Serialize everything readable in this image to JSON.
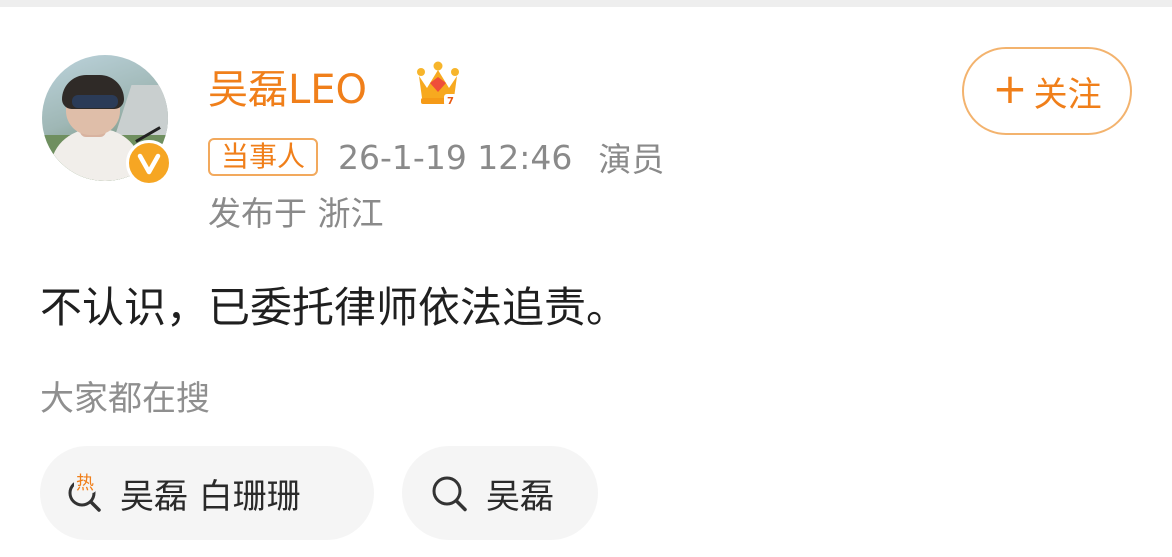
{
  "post": {
    "author": {
      "name": "吴磊LEO",
      "avatar_icon": "profile-photo",
      "verified_badge_icon": "orange-v-badge",
      "crown_icon": "member-crown-icon",
      "colors": {
        "name": "#f07f1a",
        "accent": "#f6a623"
      }
    },
    "follow_button": {
      "plus": "+",
      "label": "关注"
    },
    "meta": {
      "tag": "当事人",
      "timestamp": "26-1-19 12:46",
      "role": "演员",
      "location": "发布于 浙江"
    },
    "content": "不认识，已委托律师依法追责。"
  },
  "search_section": {
    "title": "大家都在搜",
    "chips": [
      {
        "label": "吴磊 白珊珊",
        "icon": "hot-search-icon",
        "hot_mark": "热"
      },
      {
        "label": "吴磊",
        "icon": "search-icon"
      }
    ]
  }
}
